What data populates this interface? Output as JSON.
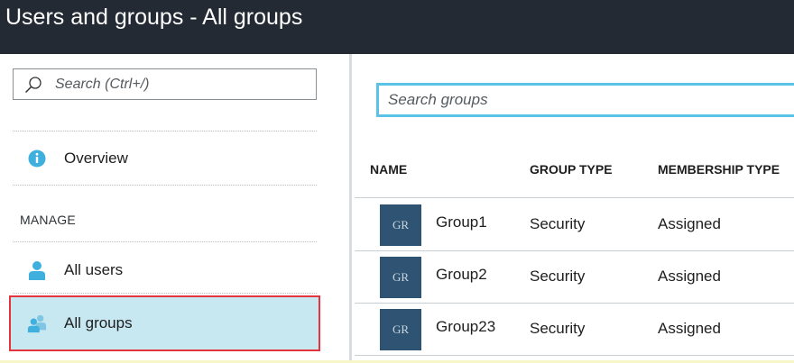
{
  "window": {
    "title": "Users and groups - All groups"
  },
  "sidebar": {
    "search_placeholder": "Search (Ctrl+/)",
    "overview_label": "Overview",
    "section_label": "MANAGE",
    "items": [
      {
        "label": "All users",
        "icon": "user-icon"
      },
      {
        "label": "All groups",
        "icon": "group-icon",
        "selected": true
      }
    ]
  },
  "main": {
    "search_placeholder": "Search groups",
    "columns": [
      "NAME",
      "GROUP TYPE",
      "MEMBERSHIP TYPE"
    ],
    "rows": [
      {
        "initials": "GR",
        "name": "Group1",
        "group_type": "Security",
        "membership_type": "Assigned"
      },
      {
        "initials": "GR",
        "name": "Group2",
        "group_type": "Security",
        "membership_type": "Assigned"
      },
      {
        "initials": "GR",
        "name": "Group23",
        "group_type": "Security",
        "membership_type": "Assigned"
      }
    ]
  },
  "colors": {
    "titlebar": "#232a33",
    "selected_bg": "#c7e7f1",
    "selected_border": "#e4343d",
    "accent": "#5bc3e6",
    "avatar": "#2f5373"
  }
}
